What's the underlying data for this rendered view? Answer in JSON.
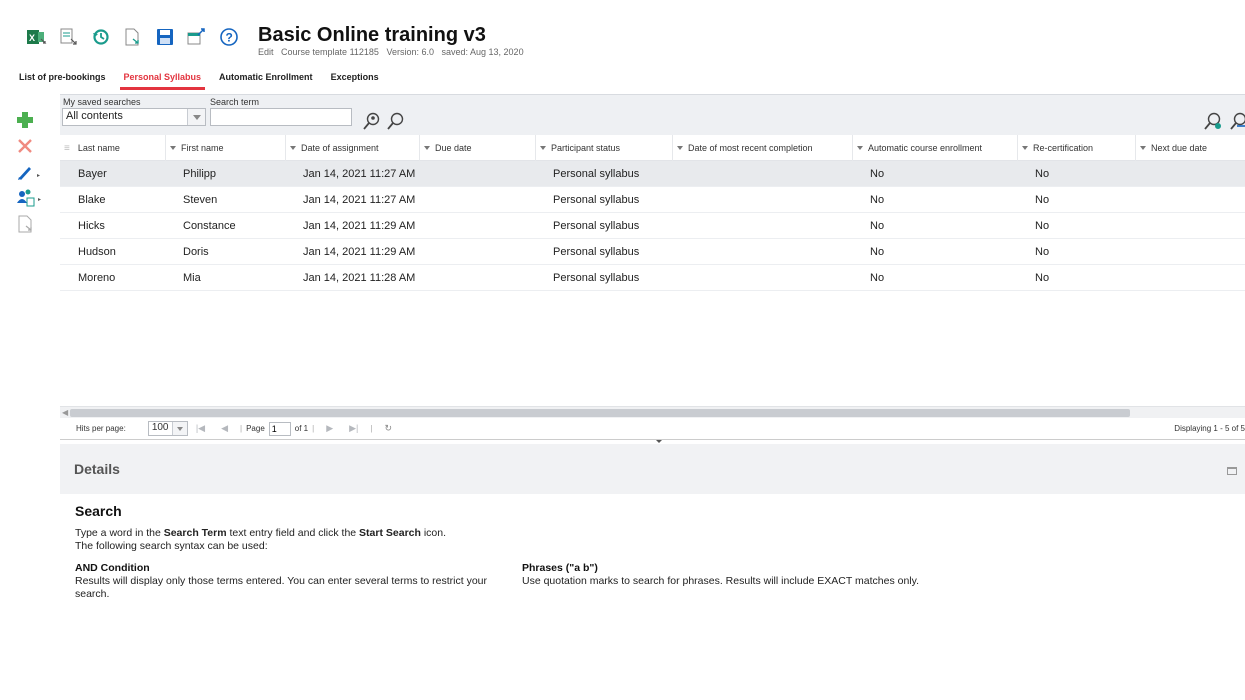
{
  "header": {
    "title": "Basic Online training v3",
    "mode": "Edit",
    "template": "Course template 112185",
    "version": "Version: 6.0",
    "saved": "saved: Aug 13, 2020"
  },
  "toolbar_icons": [
    "excel-export-icon",
    "export-doc-icon",
    "history-icon",
    "page-arrow-icon",
    "save-icon",
    "window-export-icon",
    "help-icon"
  ],
  "tabs": [
    {
      "label": "List of pre-bookings"
    },
    {
      "label": "Personal Syllabus",
      "active": true
    },
    {
      "label": "Automatic Enrollment"
    },
    {
      "label": "Exceptions"
    }
  ],
  "search": {
    "saved_label": "My saved searches",
    "saved_value": "All contents",
    "term_label": "Search term",
    "term_value": ""
  },
  "grid": {
    "columns": [
      "Last name",
      "First name",
      "Date of assignment",
      "Due date",
      "Participant status",
      "Date of most recent completion",
      "Automatic course enrollment",
      "Re-certification",
      "Next due date"
    ],
    "rows": [
      [
        "Bayer",
        "Philipp",
        "Jan 14, 2021 11:27 AM",
        "",
        "Personal syllabus",
        "",
        "No",
        "No",
        ""
      ],
      [
        "Blake",
        "Steven",
        "Jan 14, 2021 11:27 AM",
        "",
        "Personal syllabus",
        "",
        "No",
        "No",
        ""
      ],
      [
        "Hicks",
        "Constance",
        "Jan 14, 2021 11:29 AM",
        "",
        "Personal syllabus",
        "",
        "No",
        "No",
        ""
      ],
      [
        "Hudson",
        "Doris",
        "Jan 14, 2021 11:29 AM",
        "",
        "Personal syllabus",
        "",
        "No",
        "No",
        ""
      ],
      [
        "Moreno",
        "Mia",
        "Jan 14, 2021 11:28 AM",
        "",
        "Personal syllabus",
        "",
        "No",
        "No",
        ""
      ]
    ]
  },
  "pager": {
    "hits_label": "Hits per page:",
    "hits_value": "100",
    "page_label": "Page",
    "page_value": "1",
    "of_label": "of 1",
    "displaying": "Displaying 1 - 5 of 5"
  },
  "details": {
    "title": "Details"
  },
  "help": {
    "heading": "Search",
    "intro_a": "Type a word in the ",
    "intro_b": "Search Term",
    "intro_c": " text entry field and click the ",
    "intro_d": "Start Search",
    "intro_e": " icon.",
    "intro2": "The following search syntax can be used:",
    "and_title": "AND Condition",
    "and_text": "Results will display only those terms entered. You can enter several terms to restrict your search.",
    "phrase_title": "Phrases (\"a b\")",
    "phrase_text": "Use quotation marks to search for phrases. Results will include EXACT matches only."
  },
  "colors": {
    "accent_red": "#e3343f",
    "add_green": "#4caf50",
    "edit_blue": "#1565c0",
    "toolbar_teal": "#1a9b8c"
  }
}
